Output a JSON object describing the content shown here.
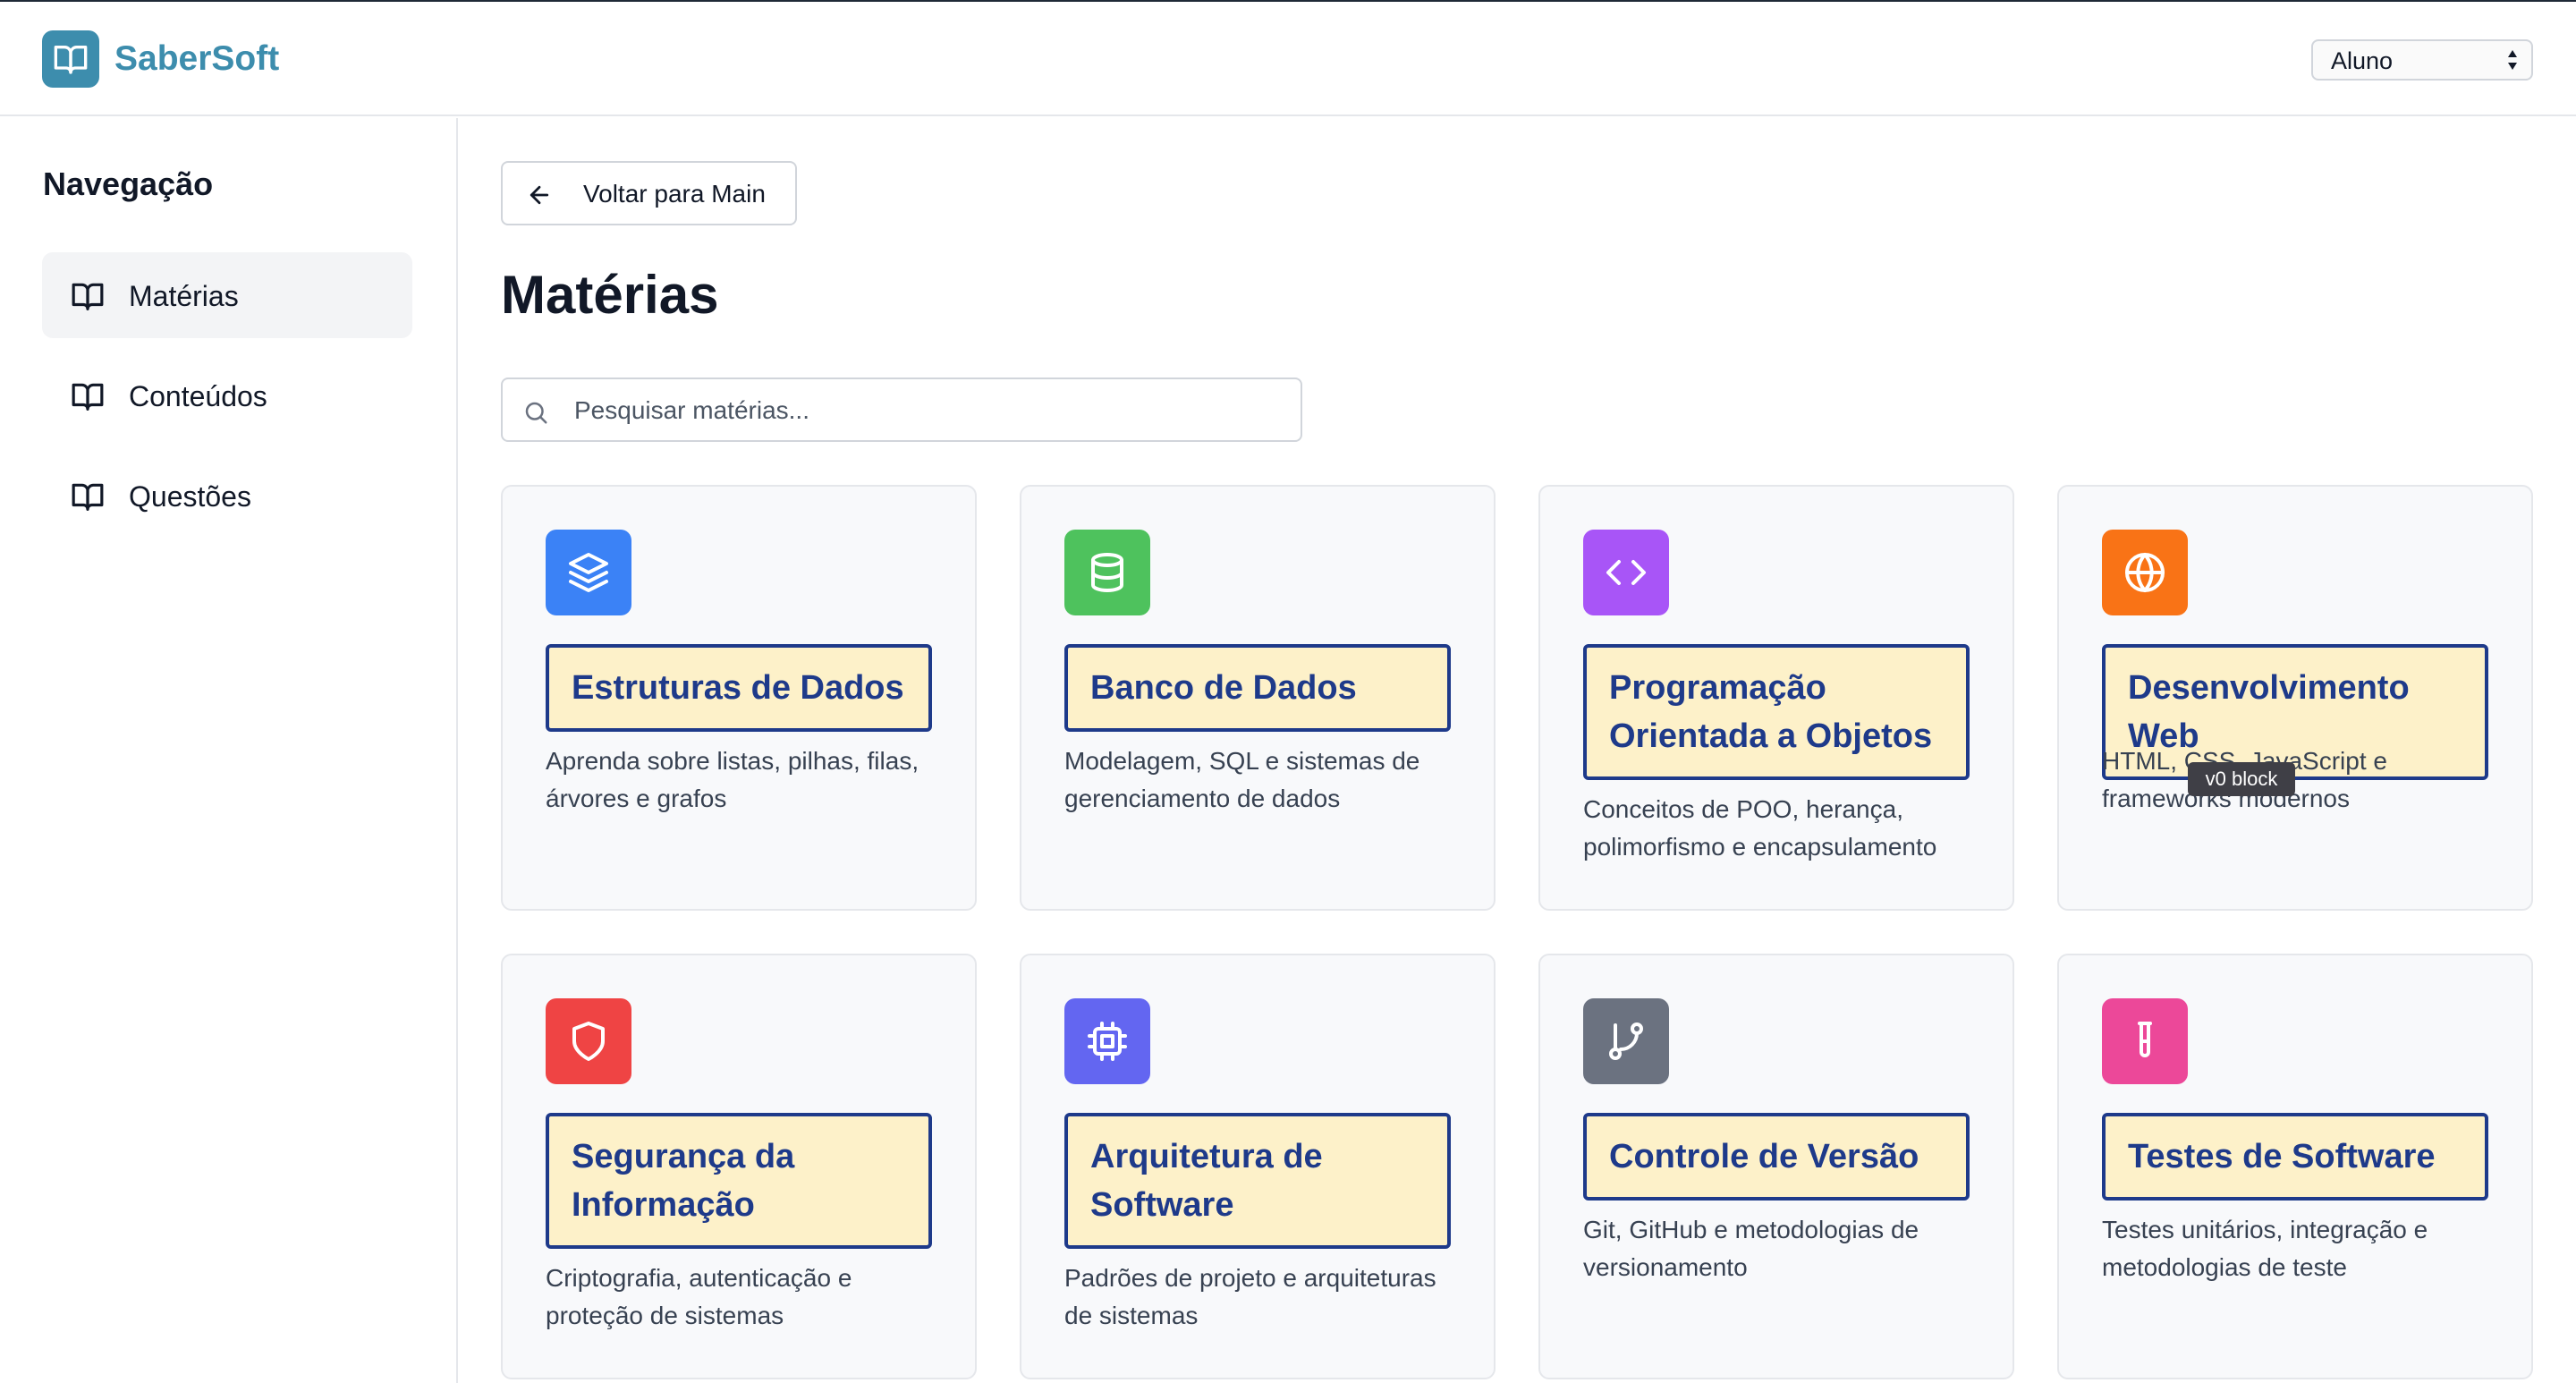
{
  "app": {
    "name": "SaberSoft"
  },
  "header": {
    "role_selected": "Aluno"
  },
  "sidebar": {
    "title": "Navegação",
    "items": [
      {
        "label": "Matérias",
        "icon": "book-open-icon",
        "active": true
      },
      {
        "label": "Conteúdos",
        "icon": "book-open-icon",
        "active": false
      },
      {
        "label": "Questões",
        "icon": "book-open-icon",
        "active": false
      }
    ]
  },
  "main": {
    "back_label": "Voltar para Main",
    "title": "Matérias",
    "search_placeholder": "Pesquisar matérias...",
    "tooltip": "v0 block",
    "subjects": [
      {
        "title": "Estruturas de Dados",
        "desc": "Aprenda sobre listas, pilhas, filas, árvores e grafos",
        "icon": "layers-icon",
        "color": "#3b82f6"
      },
      {
        "title": "Banco de Dados",
        "desc": "Modelagem, SQL e sistemas de gerenciamento de dados",
        "icon": "database-icon",
        "color": "#4ec25d"
      },
      {
        "title": "Programação Orientada a Objetos",
        "desc": "Conceitos de POO, herança, polimorfismo e encapsulamento",
        "icon": "code-icon",
        "color": "#a855f7"
      },
      {
        "title": "Desenvolvimento Web",
        "desc": "HTML, CSS, JavaScript e frameworks modernos",
        "icon": "globe-icon",
        "color": "#f97316"
      },
      {
        "title": "Segurança da Informação",
        "desc": "Criptografia, autenticação e proteção de sistemas",
        "icon": "shield-icon",
        "color": "#ef4444"
      },
      {
        "title": "Arquitetura de Software",
        "desc": "Padrões de projeto e arquiteturas de sistemas",
        "icon": "cpu-icon",
        "color": "#6366f1"
      },
      {
        "title": "Controle de Versão",
        "desc": "Git, GitHub e metodologias de versionamento",
        "icon": "git-branch-icon",
        "color": "#6b7280"
      },
      {
        "title": "Testes de Software",
        "desc": "Testes unitários, integração e metodologias de teste",
        "icon": "test-tube-icon",
        "color": "#ec4899"
      }
    ]
  }
}
